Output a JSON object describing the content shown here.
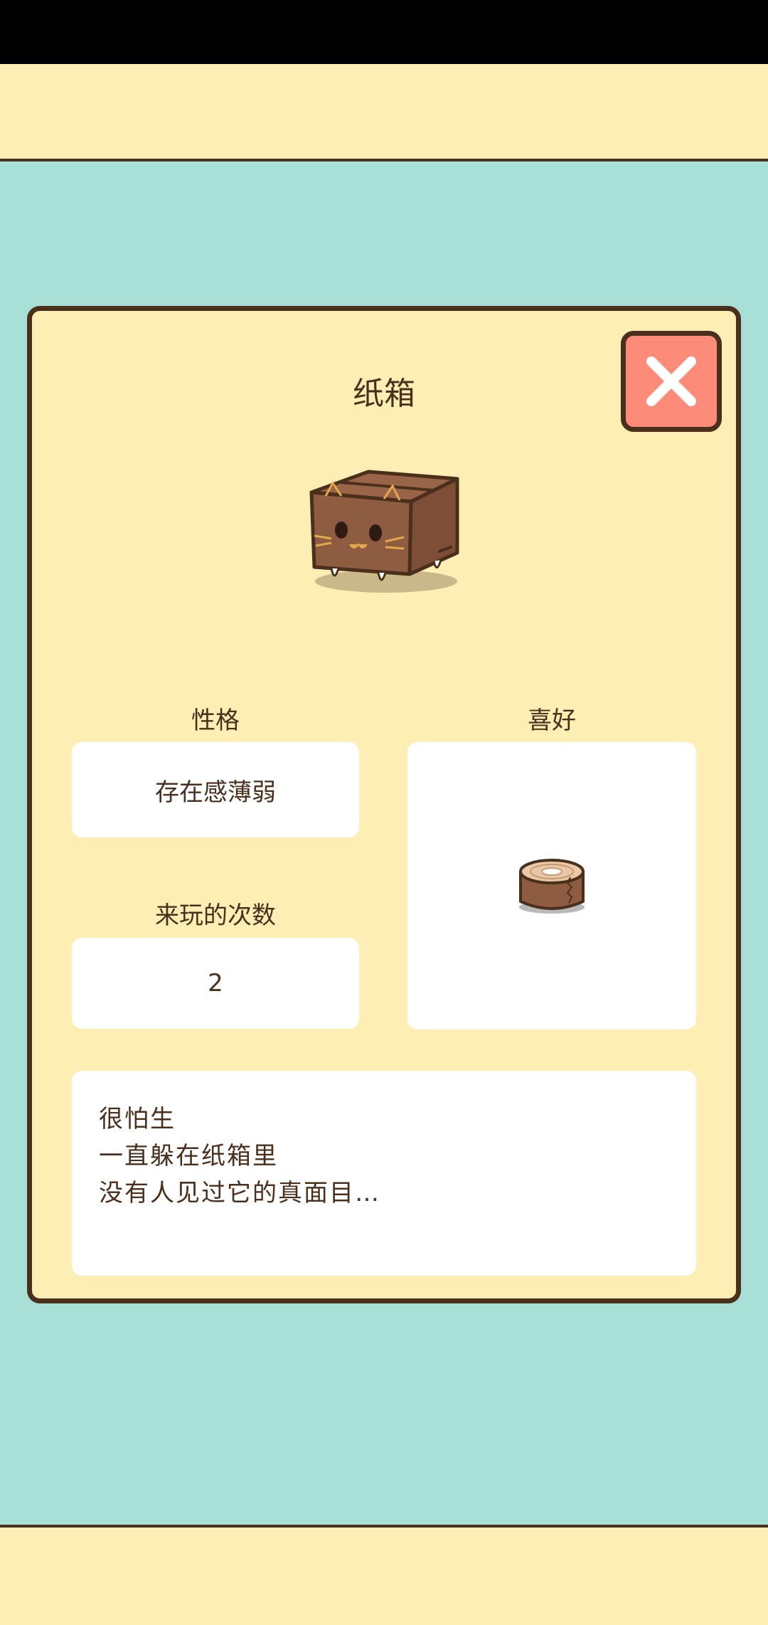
{
  "character": {
    "name": "纸箱",
    "icon": "cardboard-box-cat"
  },
  "stats": {
    "personality_label": "性格",
    "personality_value": "存在感薄弱",
    "visits_label": "来玩的次数",
    "visits_value": "2",
    "favorite_label": "喜好",
    "favorite_item_icon": "tape-roll"
  },
  "description": {
    "lines": [
      "很怕生",
      "一直躲在纸箱里",
      "没有人见过它的真面目…"
    ]
  },
  "colors": {
    "teal_background": "#a8e0d8",
    "cream_panel": "#fdeeb3",
    "close_button": "#fd8b79",
    "outline_brown": "#4a2f1d"
  }
}
